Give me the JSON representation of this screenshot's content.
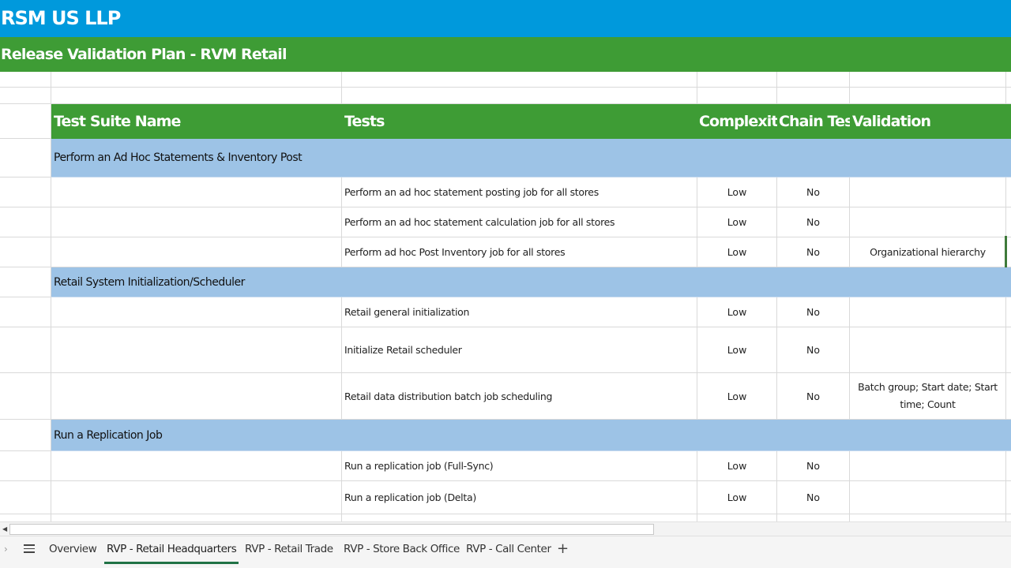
{
  "banner": {
    "company": "RSM US LLP",
    "plan_title": "Release Validation Plan - RVM Retail"
  },
  "columns": {
    "suite": "Test Suite Name",
    "tests": "Tests",
    "complexity": "Complexity",
    "chain": "Chain Test",
    "validation": "Validation"
  },
  "groups": [
    {
      "name": "Perform an Ad Hoc Statements & Inventory Post",
      "rows": [
        {
          "test": "Perform an ad hoc statement posting job for all stores",
          "complexity": "Low",
          "chain": "No",
          "validation": ""
        },
        {
          "test": "Perform an ad hoc statement calculation job for all stores",
          "complexity": "Low",
          "chain": "No",
          "validation": ""
        },
        {
          "test": "Perform ad hoc Post Inventory job for all stores",
          "complexity": "Low",
          "chain": "No",
          "validation": "Organizational hierarchy"
        }
      ]
    },
    {
      "name": "Retail System Initialization/Scheduler",
      "rows": [
        {
          "test": "Retail general initialization",
          "complexity": "Low",
          "chain": "No",
          "validation": ""
        },
        {
          "test": "Initialize Retail scheduler",
          "complexity": "Low",
          "chain": "No",
          "validation": ""
        },
        {
          "test": "Retail data distribution batch job scheduling",
          "complexity": "Low",
          "chain": "No",
          "validation": "Batch group; Start date; Start time; Count"
        }
      ]
    },
    {
      "name": "Run a Replication Job",
      "rows": [
        {
          "test": "Run a replication job (Full-Sync)",
          "complexity": "Low",
          "chain": "No",
          "validation": ""
        },
        {
          "test": "Run a replication job (Delta)",
          "complexity": "Low",
          "chain": "No",
          "validation": ""
        }
      ]
    }
  ],
  "sheet_tabs": [
    {
      "label": "Overview",
      "active": false
    },
    {
      "label": "RVP - Retail Headquarters",
      "active": true
    },
    {
      "label": "RVP - Retail Trade",
      "active": false
    },
    {
      "label": "RVP - Store Back Office",
      "active": false
    },
    {
      "label": "RVP - Call Center",
      "active": false
    }
  ],
  "icons": {
    "menu": "all-sheets-menu-icon",
    "add": "add-sheet-icon",
    "scroll_left": "scroll-left-icon",
    "nav": "sheet-nav-arrow-icon"
  },
  "colors": {
    "company_banner": "#0099dc",
    "green_header": "#3e9c35",
    "group_band": "#9dc3e6",
    "active_tab_underline": "#217346"
  }
}
